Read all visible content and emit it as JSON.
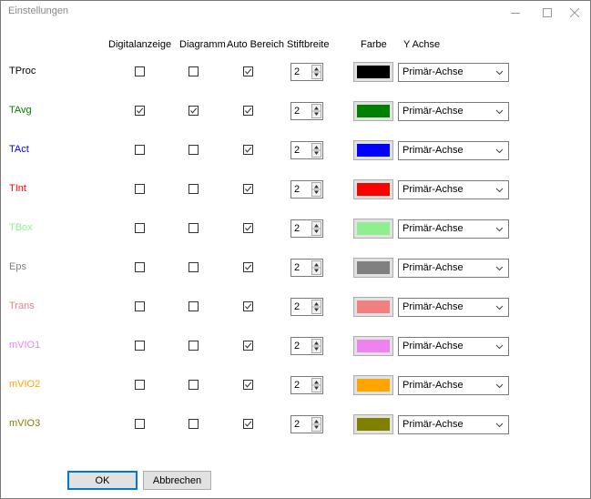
{
  "window": {
    "title": "Einstellungen"
  },
  "headers": {
    "digital": "Digitalanzeige",
    "diagramm": "Diagramm",
    "auto": "Auto Bereich",
    "stift": "Stiftbreite",
    "farbe": "Farbe",
    "achse": "Y Achse"
  },
  "rows": [
    {
      "label": "TProc",
      "label_color": "#000000",
      "digital": false,
      "diagramm": false,
      "auto": true,
      "stift": "2",
      "color": "#000000",
      "achse": "Primär-Achse"
    },
    {
      "label": "TAvg",
      "label_color": "#008000",
      "digital": true,
      "diagramm": true,
      "auto": true,
      "stift": "2",
      "color": "#008000",
      "achse": "Primär-Achse"
    },
    {
      "label": "TAct",
      "label_color": "#0000ff",
      "digital": false,
      "diagramm": false,
      "auto": true,
      "stift": "2",
      "color": "#0000ff",
      "achse": "Primär-Achse"
    },
    {
      "label": "TInt",
      "label_color": "#ff0000",
      "digital": false,
      "diagramm": false,
      "auto": true,
      "stift": "2",
      "color": "#ff0000",
      "achse": "Primär-Achse"
    },
    {
      "label": "TBox",
      "label_color": "#90ee90",
      "digital": false,
      "diagramm": false,
      "auto": true,
      "stift": "2",
      "color": "#90ee90",
      "achse": "Primär-Achse"
    },
    {
      "label": "Eps",
      "label_color": "#808080",
      "digital": false,
      "diagramm": false,
      "auto": true,
      "stift": "2",
      "color": "#808080",
      "achse": "Primär-Achse"
    },
    {
      "label": "Trans",
      "label_color": "#f08080",
      "digital": false,
      "diagramm": false,
      "auto": true,
      "stift": "2",
      "color": "#f08080",
      "achse": "Primär-Achse"
    },
    {
      "label": "mVIO1",
      "label_color": "#ee82ee",
      "digital": false,
      "diagramm": false,
      "auto": true,
      "stift": "2",
      "color": "#ee82ee",
      "achse": "Primär-Achse"
    },
    {
      "label": "mVIO2",
      "label_color": "#ffa500",
      "digital": false,
      "diagramm": false,
      "auto": true,
      "stift": "2",
      "color": "#ffa500",
      "achse": "Primär-Achse"
    },
    {
      "label": "mVIO3",
      "label_color": "#808000",
      "digital": false,
      "diagramm": false,
      "auto": true,
      "stift": "2",
      "color": "#808000",
      "achse": "Primär-Achse"
    }
  ],
  "buttons": {
    "ok": "OK",
    "cancel": "Abbrechen"
  }
}
